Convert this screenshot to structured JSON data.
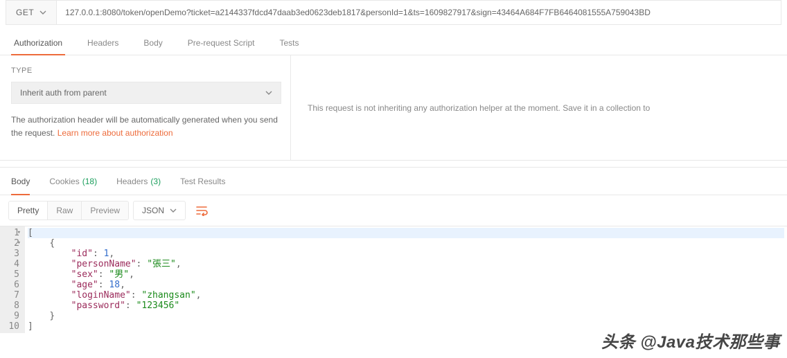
{
  "request": {
    "method": "GET",
    "url": "127.0.0.1:8080/token/openDemo?ticket=a2144337fdcd47daab3ed0623deb1817&personId=1&ts=1609827917&sign=43464A684F7FB6464081555A759043BD"
  },
  "req_tabs": {
    "authorization": "Authorization",
    "headers": "Headers",
    "body": "Body",
    "prerequest": "Pre-request Script",
    "tests": "Tests"
  },
  "auth": {
    "type_label": "TYPE",
    "selected": "Inherit auth from parent",
    "help_pre": "The authorization header will be automatically generated when you send the request. ",
    "help_link": "Learn more about authorization",
    "right_msg": "This request is not inheriting any authorization helper at the moment. Save it in a collection to"
  },
  "resp_tabs": {
    "body": "Body",
    "cookies": "Cookies",
    "cookies_count": "(18)",
    "headers": "Headers",
    "headers_count": "(3)",
    "test_results": "Test Results"
  },
  "body_toolbar": {
    "pretty": "Pretty",
    "raw": "Raw",
    "preview": "Preview",
    "format": "JSON"
  },
  "response_body": {
    "lines": [
      "1",
      "2",
      "3",
      "4",
      "5",
      "6",
      "7",
      "8",
      "9",
      "10"
    ],
    "data": [
      {
        "id": 1,
        "personName": "張三",
        "sex": "男",
        "age": 18,
        "loginName": "zhangsan",
        "password": "123456"
      }
    ]
  },
  "watermark": "头条 @Java技术那些事"
}
